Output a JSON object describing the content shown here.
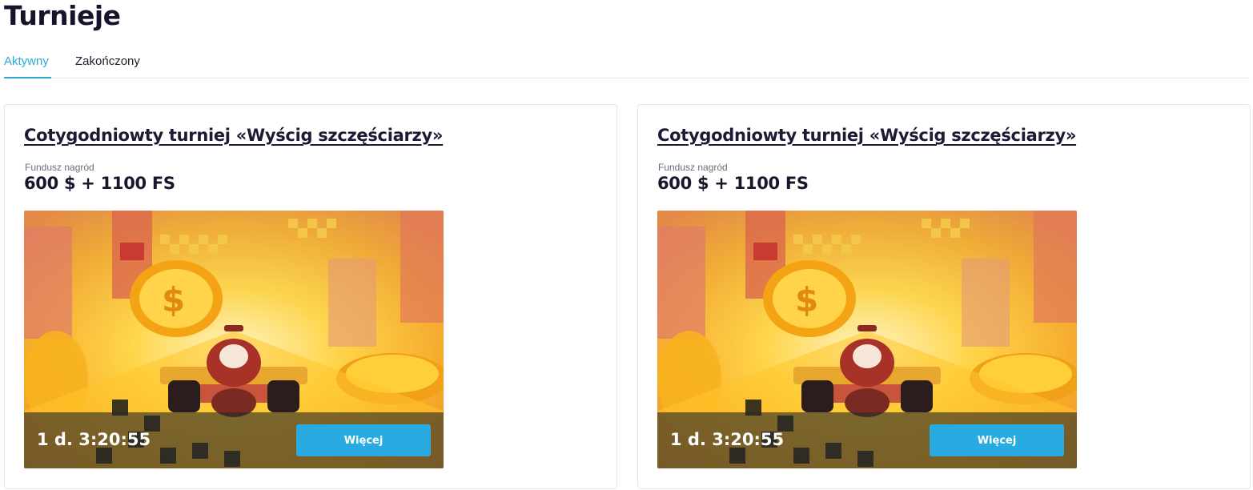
{
  "page": {
    "title": "Turnieje"
  },
  "tabs": [
    {
      "label": "Aktywny",
      "active": true
    },
    {
      "label": "Zakończony",
      "active": false
    }
  ],
  "tournaments": [
    {
      "title": "Cotygodniowty turniej «Wyścig szczęściarzy»",
      "prize_label": "Fundusz nagród",
      "prize_value": "600 $ + 1100 FS",
      "timer": "1 d. 3:20:55",
      "button_label": "Więcej"
    },
    {
      "title": "Cotygodniowty turniej «Wyścig szczęściarzy»",
      "prize_label": "Fundusz nagród",
      "prize_value": "600 $ + 1100 FS",
      "timer": "1 d. 3:20:55",
      "button_label": "Więcej"
    }
  ],
  "colors": {
    "accent": "#29abe2",
    "text": "#14142b",
    "border": "#e6e6e9"
  }
}
